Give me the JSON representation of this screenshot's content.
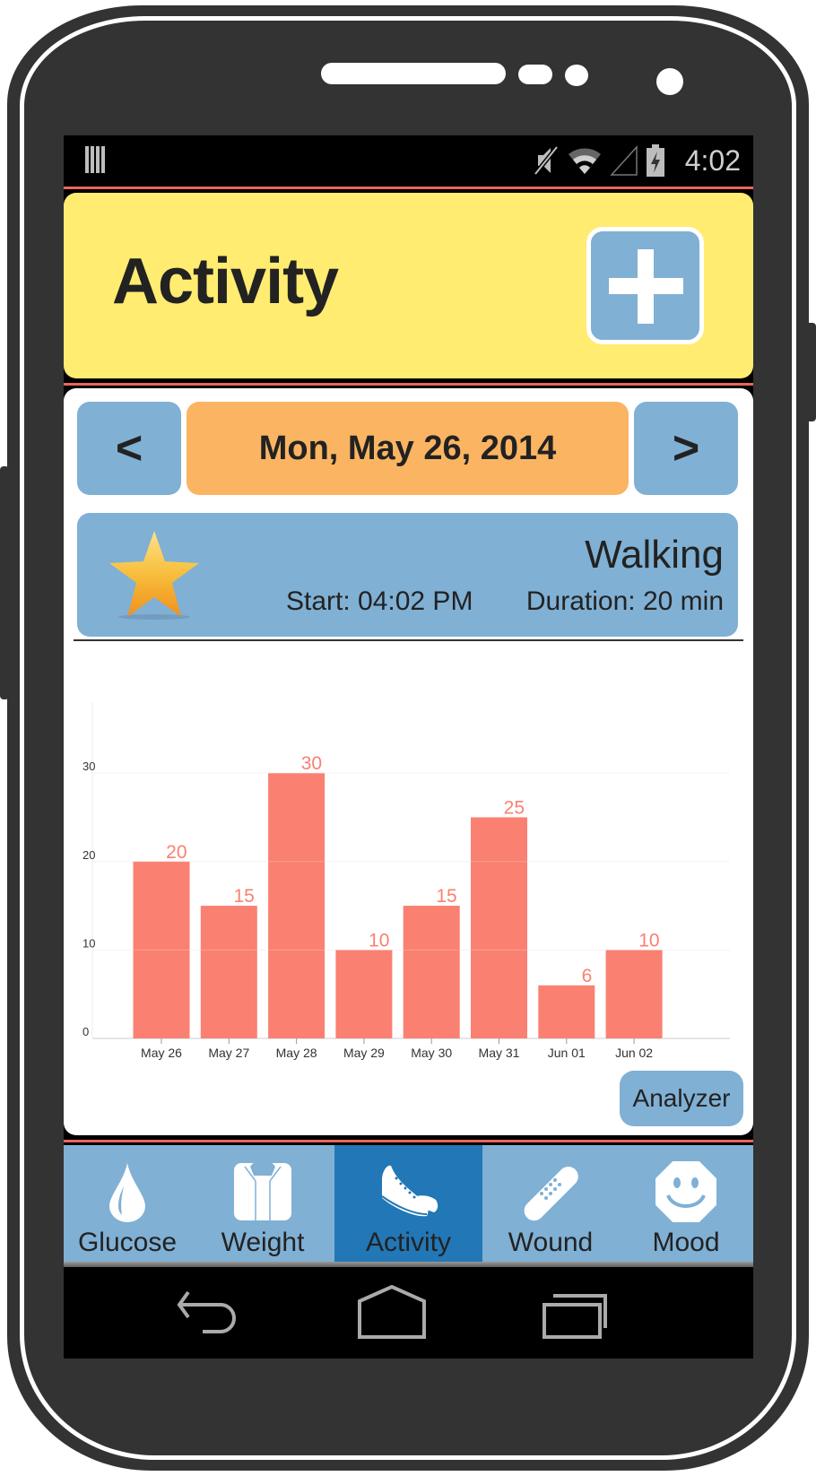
{
  "status_bar": {
    "time": "4:02",
    "icons": [
      "notification-bars-icon",
      "mute-icon",
      "wifi-icon",
      "signal-icon",
      "battery-charging-icon"
    ]
  },
  "header": {
    "title": "Activity",
    "add_button_icon": "plus-icon"
  },
  "date_nav": {
    "prev_label": "<",
    "date_label": "Mon, May 26, 2014",
    "next_label": ">"
  },
  "entry": {
    "icon": "star-icon",
    "activity": "Walking",
    "start": "Start: 04:02 PM",
    "duration": "Duration: 20 min"
  },
  "chart_data": {
    "type": "bar",
    "title": "",
    "xlabel": "",
    "ylabel": "",
    "categories": [
      "May 26",
      "May 27",
      "May 28",
      "May 29",
      "May 30",
      "May 31",
      "Jun 01",
      "Jun 02"
    ],
    "values": [
      20,
      15,
      30,
      10,
      15,
      25,
      6,
      10
    ],
    "y_ticks": [
      0,
      10,
      20,
      30
    ],
    "ylim": [
      0,
      36
    ],
    "grid": true,
    "legend": "none",
    "bar_color": "#fa8072",
    "data_labels": true
  },
  "analyzer_label": "Analyzer",
  "tabs": [
    {
      "label": "Glucose",
      "icon": "drop-icon",
      "active": false
    },
    {
      "label": "Weight",
      "icon": "scale-icon",
      "active": false
    },
    {
      "label": "Activity",
      "icon": "sneakers-icon",
      "active": true
    },
    {
      "label": "Wound",
      "icon": "bandage-icon",
      "active": false
    },
    {
      "label": "Mood",
      "icon": "smiley-icon",
      "active": false
    }
  ],
  "system_nav": [
    "back-icon",
    "home-icon",
    "recent-apps-icon"
  ],
  "colors": {
    "header_bg": "#ffec70",
    "button_blue": "#80b0d4",
    "date_orange": "#fbb462",
    "active_tab": "#2277b6",
    "bar": "#fa8072",
    "separator_red": "#e8675a"
  }
}
